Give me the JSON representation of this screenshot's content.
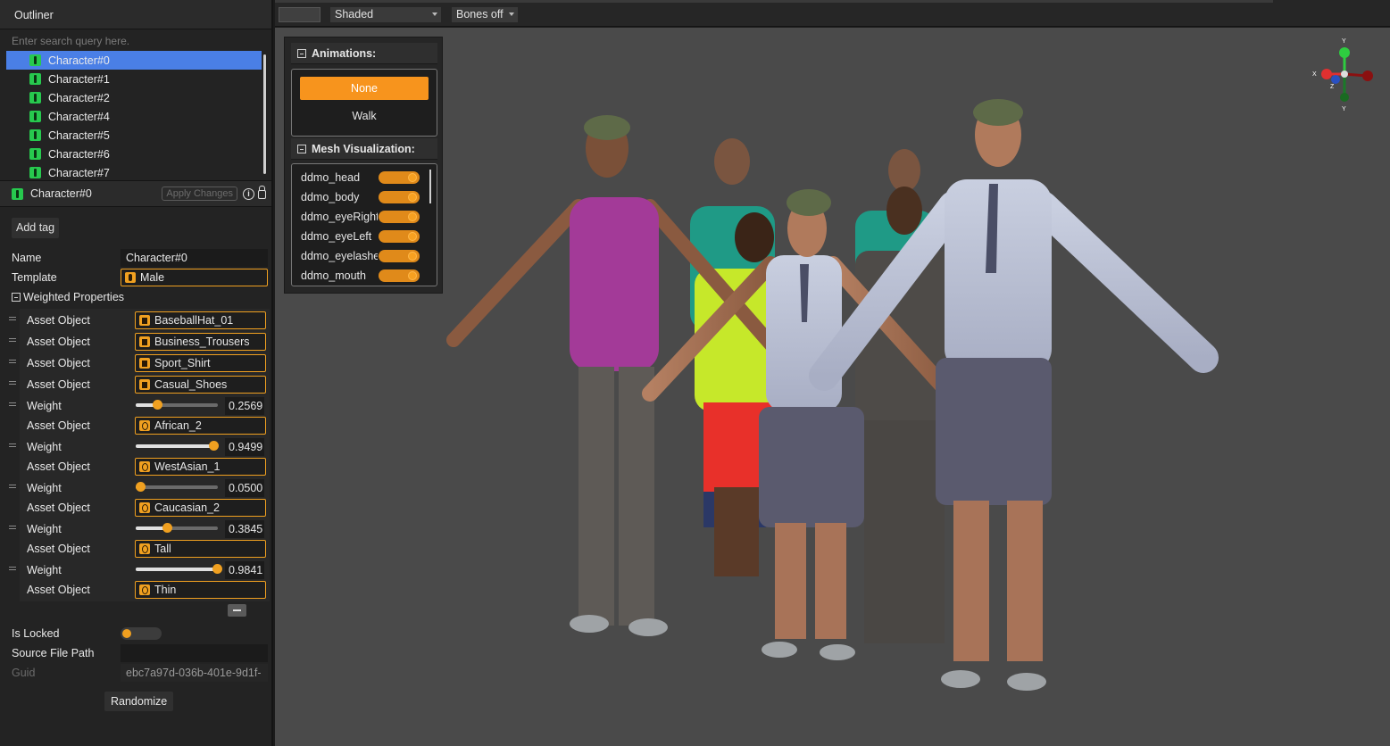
{
  "outliner": {
    "title": "Outliner",
    "search_placeholder": "Enter search query here.",
    "items": [
      "Character#0",
      "Character#1",
      "Character#2",
      "Character#4",
      "Character#5",
      "Character#6",
      "Character#7"
    ],
    "selected_index": 0
  },
  "inspector": {
    "title": "Character#0",
    "apply_label": "Apply Changes",
    "add_tag_label": "Add tag",
    "name_label": "Name",
    "name_value": "Character#0",
    "template_label": "Template",
    "template_value": "Male",
    "weighted_label": "Weighted Properties",
    "weighted": [
      {
        "kind": "asset",
        "label": "Asset Object",
        "value": "BaseballHat_01",
        "icon": "clothing-icon"
      },
      {
        "kind": "asset",
        "label": "Asset Object",
        "value": "Business_Trousers",
        "icon": "clothing-icon"
      },
      {
        "kind": "asset",
        "label": "Asset Object",
        "value": "Sport_Shirt",
        "icon": "clothing-icon"
      },
      {
        "kind": "asset",
        "label": "Asset Object",
        "value": "Casual_Shoes",
        "icon": "clothing-icon"
      },
      {
        "kind": "weight",
        "label": "Weight",
        "value": "0.2569",
        "fraction": 0.2569
      },
      {
        "kind": "asset",
        "label": "Asset Object",
        "value": "African_2",
        "icon": "morph-icon"
      },
      {
        "kind": "weight",
        "label": "Weight",
        "value": "0.9499",
        "fraction": 0.9499
      },
      {
        "kind": "asset",
        "label": "Asset Object",
        "value": "WestAsian_1",
        "icon": "morph-icon"
      },
      {
        "kind": "weight",
        "label": "Weight",
        "value": "0.0500",
        "fraction": 0.05
      },
      {
        "kind": "asset",
        "label": "Asset Object",
        "value": "Caucasian_2",
        "icon": "morph-icon"
      },
      {
        "kind": "weight",
        "label": "Weight",
        "value": "0.3845",
        "fraction": 0.3845
      },
      {
        "kind": "asset",
        "label": "Asset Object",
        "value": "Tall",
        "icon": "morph-icon"
      },
      {
        "kind": "weight",
        "label": "Weight",
        "value": "0.9841",
        "fraction": 0.9841
      },
      {
        "kind": "asset",
        "label": "Asset Object",
        "value": "Thin",
        "icon": "morph-icon"
      }
    ],
    "locked_label": "Is Locked",
    "locked": false,
    "source_label": "Source File Path",
    "source_value": "",
    "guid_label": "Guid",
    "guid_value": "ebc7a97d-036b-401e-9d1f-",
    "randomize_label": "Randomize"
  },
  "toolbar": {
    "shading": "Shaded",
    "bones": "Bones off"
  },
  "viewport": {
    "animations_title": "Animations:",
    "animations": [
      "None",
      "Walk"
    ],
    "active_animation": "None",
    "mesh_title": "Mesh Visualization:",
    "meshes": [
      {
        "name": "ddmo_head",
        "on": true
      },
      {
        "name": "ddmo_body",
        "on": true
      },
      {
        "name": "ddmo_eyeRight",
        "on": true
      },
      {
        "name": "ddmo_eyeLeft",
        "on": true
      },
      {
        "name": "ddmo_eyelashes",
        "on": true
      },
      {
        "name": "ddmo_mouth",
        "on": true
      }
    ],
    "gizmo": {
      "x": "X",
      "y": "Y",
      "z": "Z"
    }
  },
  "colors": {
    "accent": "#f7941d",
    "selection": "#4a7fe6",
    "character_icon": "#27c94e",
    "viewport_bg": "#4a4a4a"
  }
}
